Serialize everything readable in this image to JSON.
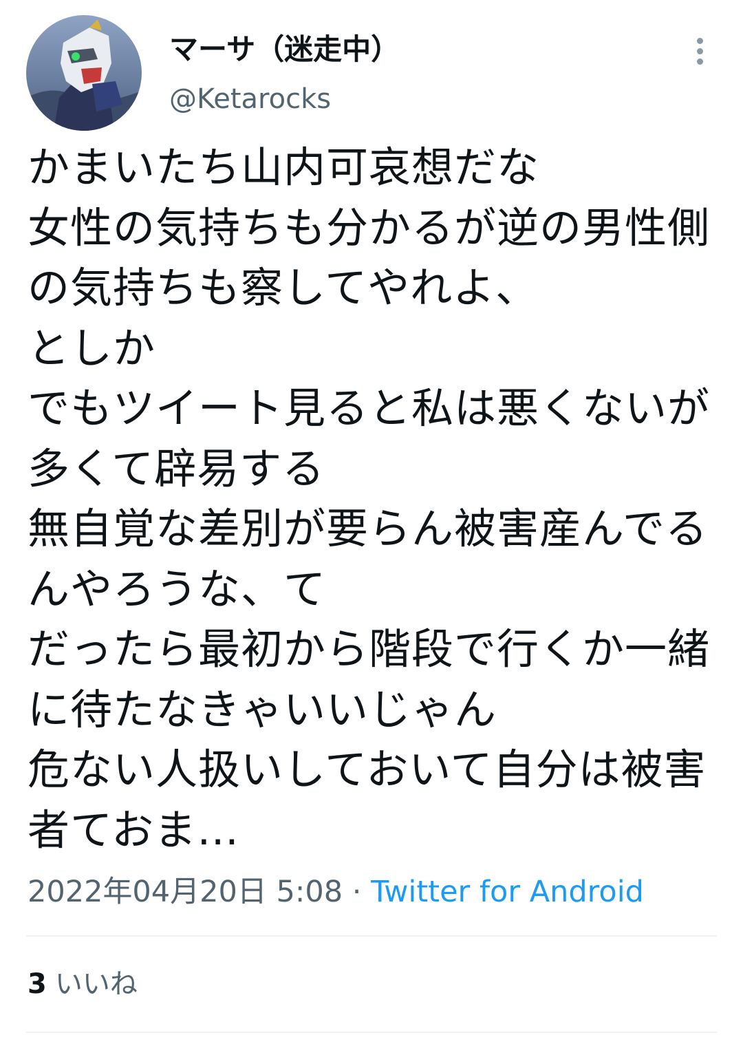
{
  "author": {
    "display_name": "マーサ（迷走中）",
    "handle": "@Ketarocks",
    "avatar": "robot-avatar-icon"
  },
  "tweet": {
    "text": "かまいたち山内可哀想だな\n女性の気持ちも分かるが逆の男性側の気持ちも察してやれよ、\nとしか\nでもツイート見ると私は悪くないが多くて辟易する\n無自覚な差別が要らん被害産んでるんやろうな、て\nだったら最初から階段で行くか一緒に待たなきゃいいじゃん\n危ない人扱いしておいて自分は被害者ておま…",
    "timestamp": "2022年04月20日 5:08",
    "separator": "·",
    "source": "Twitter for Android"
  },
  "stats": {
    "like_count": "3",
    "like_label": "いいね"
  },
  "colors": {
    "text": "#0f1419",
    "secondary": "#536471",
    "accent": "#1d9bf0",
    "divider": "#eff3f4"
  },
  "icons": {
    "more": "more-vertical-icon"
  }
}
